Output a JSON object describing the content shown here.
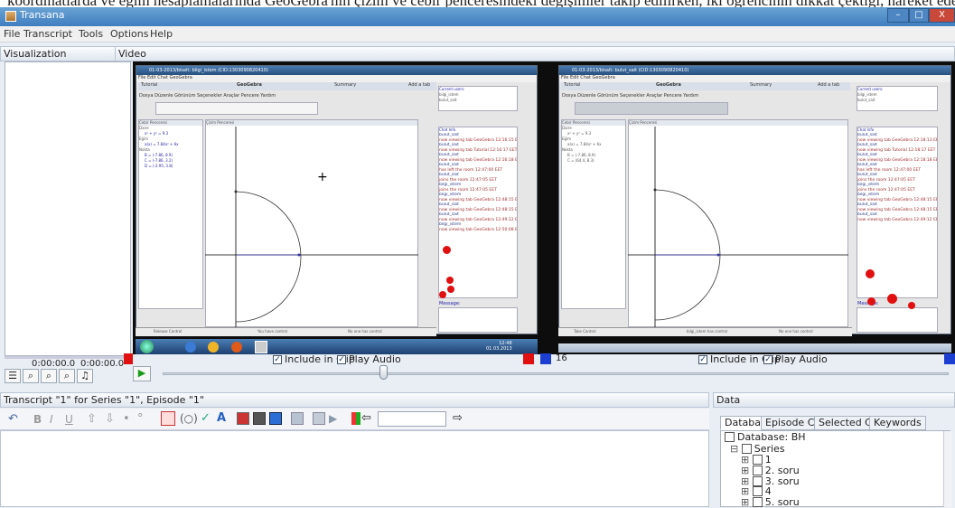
{
  "banner_text": "koordinatlarda ve eğim hesaplamalarında GeoGebra'nın çizim ve cebir penceresindeki değişimler takip edilirken, iki öğrencinin dikkat çektiği, hareket eden vektörlerin koordinatlarındaki değişikliklerin gözlemlenmesi aşamasında uygulanmıştır. Bunun yanında GeoGebra ekranlarını birbirine göre",
  "app": {
    "title": "Transana"
  },
  "menu": [
    "File",
    "Transcript",
    "Tools",
    "Options",
    "Help"
  ],
  "window_buttons": {
    "minimize": "–",
    "maximize": "□",
    "close": "X"
  },
  "visualization": {
    "header": "Visualization",
    "time_left": "0:00:00.0",
    "time_right": "0:00:00.0"
  },
  "video": {
    "header": "Video",
    "left_screen": {
      "title": "01-03-2013/bisalt: bilgi_istem (CID:1303090820410)",
      "menu": "File  Edit  Chat  GeoGebra",
      "tabs": [
        "Tutorial",
        "GeoGebra",
        "Summary"
      ],
      "add_tab": "Add a tab",
      "current_users_label": "Current users:",
      "users": [
        "bilgi_istem",
        "bulut_sait"
      ],
      "chat_label": "Chat Info",
      "algebra": [
        "Daire",
        "x² + y² = 9.3",
        "Eğim",
        "a(x) = 7.84x² + 6x",
        "Nokta",
        "B = (-7.86, 8.9)",
        "C = (-7.86, 3.2)",
        "D = (-2.95, 3.8)"
      ],
      "algebra_header": "Cebir Penceresi",
      "graphics_header": "Çizim Penceresi",
      "menu2": "Dosya  Düzenle  Görünüm  Seçenekler  Araçlar  Pencere  Yardım",
      "chat": [
        {
          "who": "bulut_sait",
          "text": "now viewing tab GeoGebra 12:16:15 EET"
        },
        {
          "who": "bulut_sait",
          "text": "now viewing tab Tutorial 12:16:17 EET"
        },
        {
          "who": "bulut_sait",
          "text": "now viewing tab GeoGebra 12:16:18 EET"
        },
        {
          "who": "bulut_sait",
          "text": "has left the room 12:47:00 EET"
        },
        {
          "who": "bulut_sait",
          "text": "joins the room 12:47:05 EET"
        },
        {
          "who": "bilgi_istem",
          "text": "joins the room 12:47:05 EET"
        },
        {
          "who": "bilgi_istem",
          "text": "now viewing tab GeoGebra 12:48:15 EET"
        },
        {
          "who": "bulut_sait",
          "text": "now viewing tab GeoGebra 12:48:15 EET"
        },
        {
          "who": "bulut_sait",
          "text": "now viewing tab GeoGebra 12:49:12 EET"
        },
        {
          "who": "bilgi_istem",
          "text": "now viewing tab GeoGebra 12:50:08 EET"
        }
      ],
      "control_label": "Release Control",
      "has_control": "You have control",
      "no_control": "No one has control",
      "messages_label": "Message:"
    },
    "right_screen": {
      "title": "01-03-2013/bisalt: bulut_sait (CID:1303090820410)",
      "menu": "File  Edit  Chat  GeoGebra",
      "tabs": [
        "Tutorial",
        "GeoGebra",
        "Summary"
      ],
      "add_tab": "Add a tab",
      "current_users_label": "Current users:",
      "users": [
        "bilgi_istem",
        "bulut_sait"
      ],
      "chat_label": "Chat Info",
      "algebra": [
        "Daire",
        "x² + y² = 9.3",
        "Eğim",
        "a(x) = 7.84x² + 6x",
        "Nokta",
        "B = (-7.86, 8.9)",
        "C = (64.4, 8.3)"
      ],
      "algebra_header": "Cebir Penceresi",
      "graphics_header": "Çizim Penceresi",
      "menu2": "Dosya  Düzenle  Görünüm  Seçenekler  Araçlar  Pencere  Yardım",
      "chat": [
        {
          "who": "bulut_sait",
          "text": "now viewing tab GeoGebra 12:18:13 EET"
        },
        {
          "who": "bulut_sait",
          "text": "now viewing tab Tutorial 12:18:17 EET"
        },
        {
          "who": "bulut_sait",
          "text": "now viewing tab GeoGebra 12:18:18 EET"
        },
        {
          "who": "bulut_sait",
          "text": "has left the room 12:47:00 EET"
        },
        {
          "who": "bulut_sait",
          "text": "joins the room 12:47:05 EET"
        },
        {
          "who": "bilgi_istem",
          "text": "joins the room 12:47:05 EET"
        },
        {
          "who": "bilgi_istem",
          "text": "now viewing tab GeoGebra 12:48:15 EET"
        },
        {
          "who": "bulut_sait",
          "text": "now viewing tab GeoGebra 12:48:15 EET"
        },
        {
          "who": "bulut_sait",
          "text": "now viewing tab GeoGebra 12:49:12 EET"
        }
      ],
      "control_label": "Take Control",
      "has_control": "bilgi_istem has control",
      "no_control": "No one has control",
      "messages_label": "Message:"
    },
    "taskbar_time": "12:48\n01.03.2013",
    "include_label": "Include in Clip",
    "play_audio_label": "Play Audio",
    "clip_number": "16"
  },
  "transcript": {
    "header": "Transcript \"1\" for Series \"1\", Episode \"1\"",
    "search_placeholder": ""
  },
  "data_panel": {
    "header": "Data",
    "tabs": [
      "Database",
      "Episode Clips",
      "Selected Clips",
      "Keywords"
    ],
    "database_label": "Database: BH",
    "series_label": "Series",
    "items": [
      "1",
      "2. soru",
      "3. soru",
      "4",
      "5. soru"
    ]
  },
  "colors": {
    "accent_blue": "#1c6fd1",
    "red_marker": "#e01010",
    "titlebar": "#3d7cbf"
  }
}
